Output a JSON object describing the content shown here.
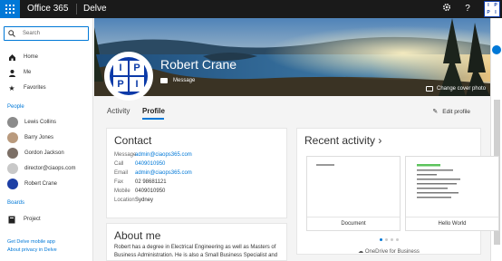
{
  "topbar": {
    "suite_name": "Office 365",
    "app_name": "Delve",
    "settings_icon": "gear-icon",
    "help_label": "?",
    "avatar_letters": [
      "I",
      "P",
      "P",
      "I"
    ]
  },
  "leftnav": {
    "search_placeholder": "Search",
    "items": [
      {
        "label": "Home",
        "icon": "home-icon"
      },
      {
        "label": "Me",
        "icon": "me-icon"
      },
      {
        "label": "Favorites",
        "icon": "star-icon"
      }
    ],
    "people_title": "People",
    "people": [
      {
        "label": "Lewis Collins",
        "color": "#8b8b8b"
      },
      {
        "label": "Barry Jones",
        "color": "#b99a7d"
      },
      {
        "label": "Gordon Jackson",
        "color": "#7c6f66"
      },
      {
        "label": "director@ciaops.com",
        "color": "#c8c8c8"
      },
      {
        "label": "Robert Crane",
        "color": "#1d3fa5"
      }
    ],
    "boards_title": "Boards",
    "boards": [
      {
        "label": "Project",
        "icon": "board-icon"
      }
    ],
    "footer": [
      "Get Delve mobile app",
      "About privacy in Delve"
    ]
  },
  "hero": {
    "name": "Robert Crane",
    "message_label": "Message",
    "change_cover_label": "Change cover photo",
    "profile_letters": [
      "I",
      "P",
      "P",
      "I"
    ]
  },
  "tabs": {
    "activity": "Activity",
    "profile": "Profile",
    "edit_profile": "Edit profile"
  },
  "contact": {
    "title": "Contact",
    "rows": [
      {
        "label": "Message",
        "value": "admin@ciaops365.com",
        "link": true
      },
      {
        "label": "Call",
        "value": "0409010950",
        "link": true
      },
      {
        "label": "Email",
        "value": "admin@ciaops365.com",
        "link": true
      },
      {
        "label": "Fax",
        "value": "02 98681121",
        "link": false
      },
      {
        "label": "Mobile",
        "value": "0409010950",
        "link": false
      },
      {
        "label": "Location",
        "value": "Sydney",
        "link": false
      }
    ]
  },
  "about": {
    "title": "About me",
    "text": "Robert has a degree in Electrical Engineering as well as Masters of Business Administration. He is also a Small Business Specialist and"
  },
  "recent": {
    "title": "Recent activity",
    "chevron": "›",
    "docs": [
      {
        "label": "Document"
      },
      {
        "label": "Hello World"
      }
    ],
    "onedrive_label": "OneDrive for Business",
    "accent": "#0078d7"
  }
}
